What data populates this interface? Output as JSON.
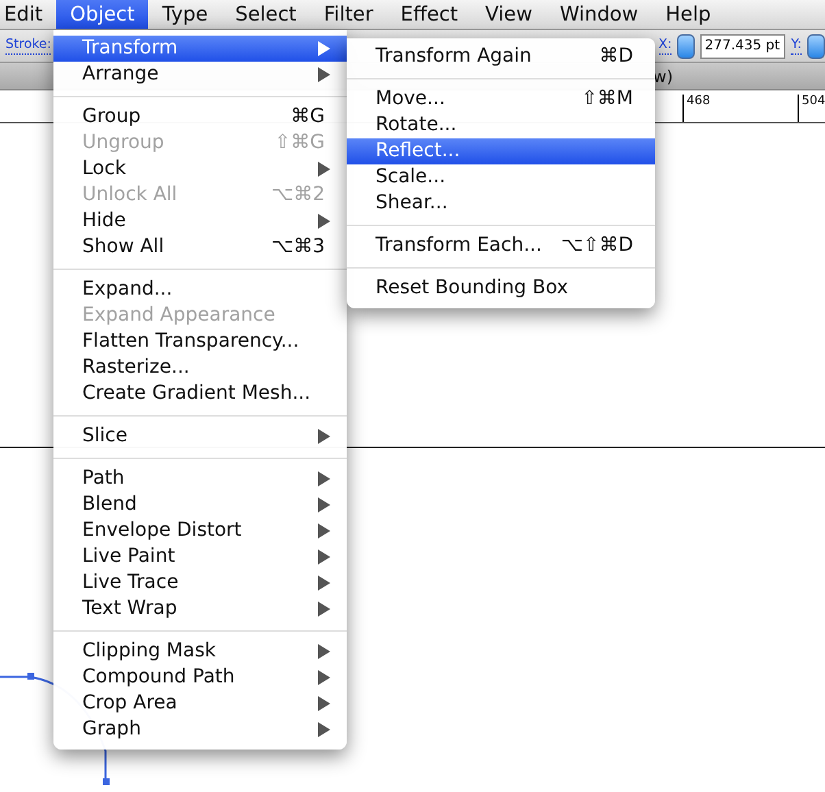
{
  "menu_bar": [
    {
      "label": "Edit",
      "selected": false
    },
    {
      "label": "Object",
      "selected": true
    },
    {
      "label": "Type",
      "selected": false
    },
    {
      "label": "Select",
      "selected": false
    },
    {
      "label": "Filter",
      "selected": false
    },
    {
      "label": "Effect",
      "selected": false
    },
    {
      "label": "View",
      "selected": false
    },
    {
      "label": "Window",
      "selected": false
    },
    {
      "label": "Help",
      "selected": false
    }
  ],
  "control_bar": {
    "stroke_label": "Stroke:",
    "x_label": "X:",
    "x_value": "277.435 pt",
    "y_label": "Y:"
  },
  "document_tab": {
    "title": "w)"
  },
  "ruler": {
    "labels": [
      "468",
      "504"
    ]
  },
  "object_menu": {
    "items": [
      {
        "kind": "item",
        "label": "Transform",
        "submenu": true,
        "disabled": false,
        "selected": true
      },
      {
        "kind": "item",
        "label": "Arrange",
        "submenu": true,
        "disabled": false,
        "selected": false
      },
      {
        "kind": "separator"
      },
      {
        "kind": "item",
        "label": "Group",
        "shortcut": "⌘G",
        "disabled": false,
        "selected": false
      },
      {
        "kind": "item",
        "label": "Ungroup",
        "shortcut": "⇧⌘G",
        "disabled": true,
        "selected": false
      },
      {
        "kind": "item",
        "label": "Lock",
        "submenu": true,
        "disabled": false,
        "selected": false
      },
      {
        "kind": "item",
        "label": "Unlock All",
        "shortcut": "⌥⌘2",
        "disabled": true,
        "selected": false
      },
      {
        "kind": "item",
        "label": "Hide",
        "submenu": true,
        "disabled": false,
        "selected": false
      },
      {
        "kind": "item",
        "label": "Show All",
        "shortcut": "⌥⌘3",
        "disabled": false,
        "selected": false
      },
      {
        "kind": "separator"
      },
      {
        "kind": "item",
        "label": "Expand...",
        "disabled": false,
        "selected": false
      },
      {
        "kind": "item",
        "label": "Expand Appearance",
        "disabled": true,
        "selected": false
      },
      {
        "kind": "item",
        "label": "Flatten Transparency...",
        "disabled": false,
        "selected": false
      },
      {
        "kind": "item",
        "label": "Rasterize...",
        "disabled": false,
        "selected": false
      },
      {
        "kind": "item",
        "label": "Create Gradient Mesh...",
        "disabled": false,
        "selected": false
      },
      {
        "kind": "separator"
      },
      {
        "kind": "item",
        "label": "Slice",
        "submenu": true,
        "disabled": false,
        "selected": false
      },
      {
        "kind": "separator"
      },
      {
        "kind": "item",
        "label": "Path",
        "submenu": true,
        "disabled": false,
        "selected": false
      },
      {
        "kind": "item",
        "label": "Blend",
        "submenu": true,
        "disabled": false,
        "selected": false
      },
      {
        "kind": "item",
        "label": "Envelope Distort",
        "submenu": true,
        "disabled": false,
        "selected": false
      },
      {
        "kind": "item",
        "label": "Live Paint",
        "submenu": true,
        "disabled": false,
        "selected": false
      },
      {
        "kind": "item",
        "label": "Live Trace",
        "submenu": true,
        "disabled": false,
        "selected": false
      },
      {
        "kind": "item",
        "label": "Text Wrap",
        "submenu": true,
        "disabled": false,
        "selected": false
      },
      {
        "kind": "separator"
      },
      {
        "kind": "item",
        "label": "Clipping Mask",
        "submenu": true,
        "disabled": false,
        "selected": false
      },
      {
        "kind": "item",
        "label": "Compound Path",
        "submenu": true,
        "disabled": false,
        "selected": false
      },
      {
        "kind": "item",
        "label": "Crop Area",
        "submenu": true,
        "disabled": false,
        "selected": false
      },
      {
        "kind": "item",
        "label": "Graph",
        "submenu": true,
        "disabled": false,
        "selected": false
      }
    ]
  },
  "transform_submenu": {
    "items": [
      {
        "kind": "item",
        "label": "Transform Again",
        "shortcut": "⌘D",
        "disabled": false,
        "selected": false
      },
      {
        "kind": "separator"
      },
      {
        "kind": "item",
        "label": "Move...",
        "shortcut": "⇧⌘M",
        "disabled": false,
        "selected": false
      },
      {
        "kind": "item",
        "label": "Rotate...",
        "disabled": false,
        "selected": false
      },
      {
        "kind": "item",
        "label": "Reflect...",
        "disabled": false,
        "selected": true
      },
      {
        "kind": "item",
        "label": "Scale...",
        "disabled": false,
        "selected": false
      },
      {
        "kind": "item",
        "label": "Shear...",
        "disabled": false,
        "selected": false
      },
      {
        "kind": "separator"
      },
      {
        "kind": "item",
        "label": "Transform Each...",
        "shortcut": "⌥⇧⌘D",
        "disabled": false,
        "selected": false
      },
      {
        "kind": "separator"
      },
      {
        "kind": "item",
        "label": "Reset Bounding Box",
        "disabled": false,
        "selected": false
      }
    ]
  }
}
